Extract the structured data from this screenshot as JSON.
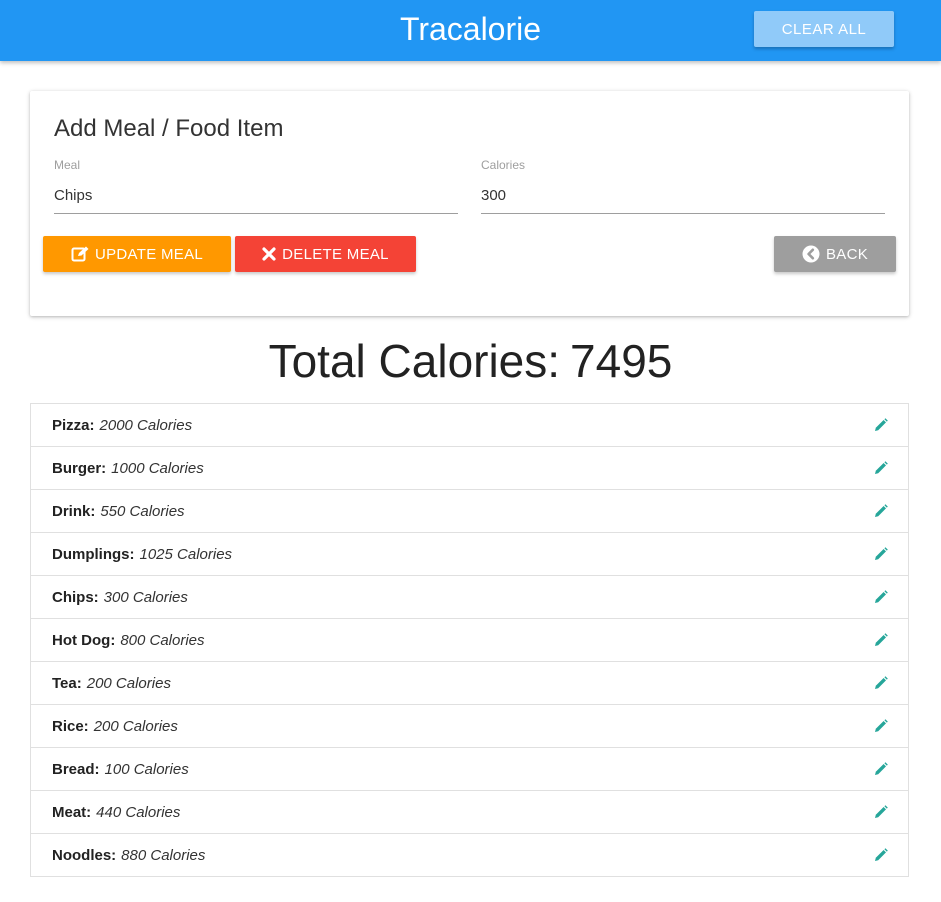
{
  "header": {
    "brand": "Tracalorie",
    "clear_all_label": "CLEAR ALL",
    "bg_color": "#2196f3"
  },
  "form": {
    "title": "Add Meal / Food Item",
    "meal_label": "Meal",
    "meal_value": "Chips",
    "calories_label": "Calories",
    "calories_value": "300",
    "update_label": "UPDATE MEAL",
    "update_icon": "edit-icon",
    "delete_label": "DELETE MEAL",
    "delete_icon": "close-icon",
    "back_label": "BACK",
    "back_icon": "chevron-left-circle-icon",
    "colors": {
      "update": "#ff9800",
      "delete": "#f44336",
      "back": "#9e9e9e"
    }
  },
  "total": {
    "label": "Total Calories:",
    "value": "7495"
  },
  "items": [
    {
      "name": "Pizza:",
      "calories": "2000 Calories"
    },
    {
      "name": "Burger:",
      "calories": "1000 Calories"
    },
    {
      "name": "Drink:",
      "calories": "550 Calories"
    },
    {
      "name": "Dumplings:",
      "calories": "1025 Calories"
    },
    {
      "name": "Chips:",
      "calories": "300 Calories"
    },
    {
      "name": "Hot Dog:",
      "calories": "800 Calories"
    },
    {
      "name": "Tea:",
      "calories": "200 Calories"
    },
    {
      "name": "Rice:",
      "calories": "200 Calories"
    },
    {
      "name": "Bread:",
      "calories": "100 Calories"
    },
    {
      "name": "Meat:",
      "calories": "440 Calories"
    },
    {
      "name": "Noodles:",
      "calories": "880 Calories"
    }
  ],
  "item_edit_icon": "pencil-icon",
  "item_edit_color": "#26a69a"
}
